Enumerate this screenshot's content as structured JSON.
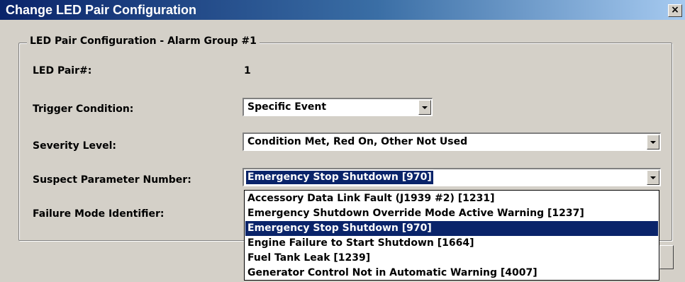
{
  "window": {
    "title": "Change LED Pair Configuration",
    "close_glyph": "×"
  },
  "group": {
    "legend": "LED Pair Configuration - Alarm Group #1"
  },
  "fields": {
    "led_pair_label": "LED Pair#:",
    "led_pair_value": "1",
    "trigger_label": "Trigger Condition:",
    "trigger_value": "Specific Event",
    "severity_label": "Severity Level:",
    "severity_value": "Condition Met, Red On, Other Not Used",
    "spn_label": "Suspect Parameter Number:",
    "spn_value": "Emergency Stop Shutdown [970]",
    "fmi_label": "Failure Mode Identifier:"
  },
  "spn_dropdown": {
    "selected_index": 2,
    "options": [
      "Accessory Data Link Fault (J1939 #2) [1231]",
      "Emergency Shutdown Override Mode Active Warning [1237]",
      "Emergency Stop Shutdown [970]",
      "Engine Failure to Start Shutdown [1664]",
      "Fuel Tank Leak [1239]",
      "Generator Control Not in Automatic Warning [4007]"
    ]
  },
  "colors": {
    "title_bar": "#0a246a",
    "selection": "#0a246a",
    "face": "#d4d0c8"
  }
}
